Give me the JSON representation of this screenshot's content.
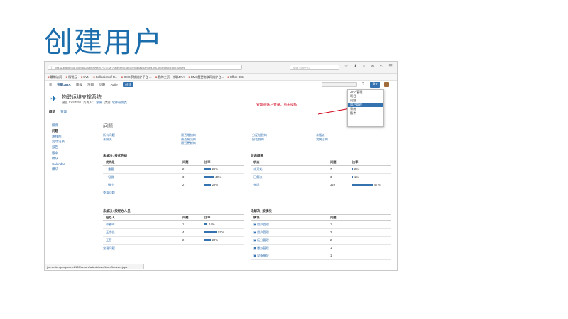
{
  "slide": {
    "title": "创建用户"
  },
  "browser": {
    "url": "jira.wuliangroup.com:8128/browse/SYSTEM/?selectedTab=com.atlassian.jira.jira-projects-plugin:issues",
    "search_placeholder": "Bing <Ctrl+K>",
    "bookmarks": [
      "最常访问",
      "科锐云",
      "SVN",
      "Collection of R...",
      "OMS系统维护平台-...",
      "我的主页 - 物联JIRA",
      "BMS备受物联网维护台...",
      "Office 365"
    ],
    "status_url": "jira.wuliangroup.com:8128/secure/admin/user/UserBrowser.jspa"
  },
  "jira": {
    "menu": {
      "logo": "物联JIRA",
      "dashboards": "面板",
      "projects": "项目",
      "issues": "问题",
      "agile": "Agile",
      "create": "创建"
    },
    "admin_menu": [
      "JIRA管理",
      "项目",
      "问题",
      "用户管理",
      "系统",
      "插件"
    ],
    "admin_selected_index": 3
  },
  "annotation": "管理员账户登录，点击操作",
  "project": {
    "name": "物联运维支撑系统",
    "meta": {
      "key_label": "键值",
      "key": "SYSTEM",
      "lead_label": "负责人：",
      "lead": "邹伟",
      "category_label": "类别",
      "category": "软件研发类"
    },
    "tabs": [
      "概览",
      "管理"
    ]
  },
  "left_nav": [
    "概要",
    "问题",
    "路线图",
    "变动记录",
    "报告",
    "版本",
    "模块",
    "Calendar",
    "模块"
  ],
  "left_nav_current_index": 1,
  "issues_section": {
    "title": "问题",
    "filter_columns": [
      [
        "所有问题",
        "未解决"
      ],
      [
        "最近增加的",
        "最近解决的",
        "最近更新的"
      ],
      [
        "分配给我的",
        "报告我的"
      ],
      [
        "未指派",
        "我关注的"
      ]
    ]
  },
  "widgets": {
    "by_priority": {
      "title": "未解决: 按优先级",
      "headers": [
        "优先级",
        "问题",
        "比率"
      ],
      "rows": [
        {
          "label": "重要",
          "icon": "↑",
          "icon_color": "#d04437",
          "count": "2",
          "pct": "29%",
          "pct_value": 29
        },
        {
          "label": "轻微",
          "icon": "↑",
          "icon_color": "#3b7fc4",
          "count": "3",
          "pct": "43%",
          "pct_value": 43
        },
        {
          "label": "微小",
          "icon": "↓",
          "icon_color": "#3b7fc4",
          "count": "2",
          "pct": "29%",
          "pct_value": 29
        }
      ],
      "more": "查看问题"
    },
    "status_summary": {
      "title": "状态概要",
      "headers": [
        "状态",
        "问题",
        "比率"
      ],
      "rows": [
        {
          "label": "未开始",
          "count": "7",
          "pct": "2%",
          "pct_value": 2
        },
        {
          "label": "已解决",
          "count": "3",
          "pct": "1%",
          "pct_value": 1
        },
        {
          "label": "关闭",
          "count": "329",
          "pct": "97%",
          "pct_value": 97
        }
      ]
    },
    "by_assignee": {
      "title": "未解决: 按经办人员",
      "headers": [
        "经办人",
        "问题",
        "比率"
      ],
      "rows": [
        {
          "label": "郭春晖",
          "count": "1",
          "pct": "14%",
          "pct_value": 14
        },
        {
          "label": "王宗佳",
          "count": "4",
          "pct": "57%",
          "pct_value": 57
        },
        {
          "label": "王茜",
          "count": "2",
          "pct": "29%",
          "pct_value": 29
        }
      ],
      "more": "查看问题"
    },
    "by_component": {
      "title": "未解决: 按模块",
      "headers": [
        "模块",
        "问题"
      ],
      "rows": [
        {
          "label": "用户管理",
          "count": "1"
        },
        {
          "label": "用户管理",
          "count": "2"
        },
        {
          "label": "板分管理",
          "count": "2"
        },
        {
          "label": "服务管理",
          "count": "1"
        },
        {
          "label": "设备模块",
          "count": "1"
        }
      ]
    }
  },
  "colors": {
    "title": "#1c6dab",
    "jira_blue": "#3572b0",
    "annotation": "#d0021b"
  }
}
